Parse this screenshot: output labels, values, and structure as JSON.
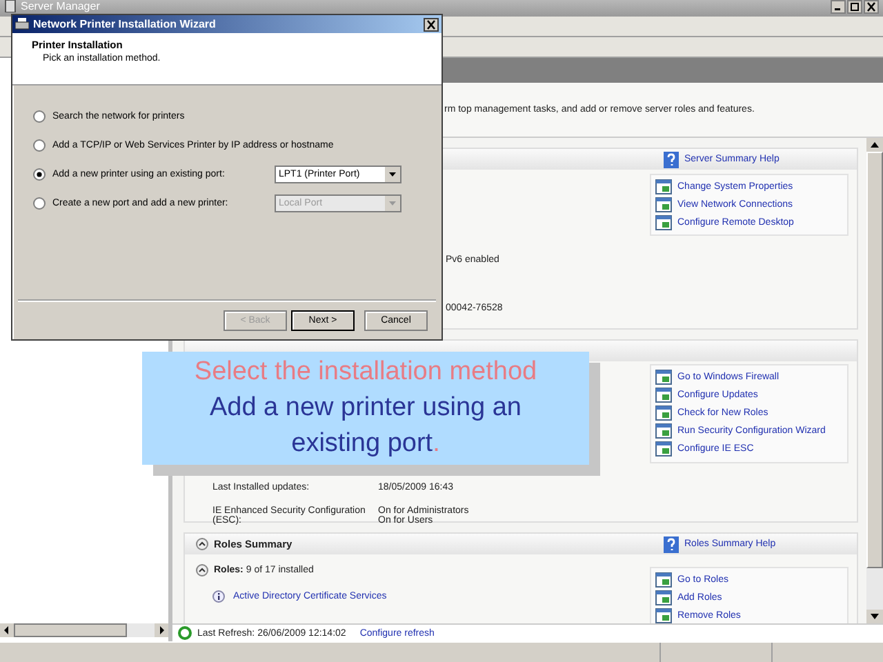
{
  "server_manager": {
    "title": "Server Manager",
    "description": "rm top management tasks, and add or remove server roles and features.",
    "server_summary": {
      "help": "Server Summary Help",
      "details": [
        "Pv6 enabled",
        "00042-76528"
      ],
      "tasks": [
        "Change System Properties",
        "View Network Connections",
        "Configure Remote Desktop"
      ]
    },
    "security": {
      "tasks": [
        "Go to Windows Firewall",
        "Configure Updates",
        "Check for New Roles",
        "Run Security Configuration Wizard",
        "Configure IE ESC"
      ],
      "details": [
        {
          "label": "Last Installed updates:",
          "values": [
            "18/05/2009 16:43"
          ]
        },
        {
          "label": "IE Enhanced Security Configuration (ESC):",
          "values": [
            "On for Administrators",
            "On for Users"
          ]
        }
      ]
    },
    "roles_summary": {
      "title": "Roles Summary",
      "help": "Roles Summary Help",
      "roles_label": "Roles:",
      "roles_count": "9 of 17 installed",
      "roles": [
        "Active Directory Certificate Services"
      ],
      "tasks": [
        "Go to Roles",
        "Add Roles",
        "Remove Roles"
      ]
    },
    "last_refresh": "Last Refresh: 26/06/2009 12:14:02",
    "configure_refresh": "Configure refresh"
  },
  "wizard": {
    "title": "Network Printer Installation Wizard",
    "heading": "Printer Installation",
    "subheading": "Pick an installation method.",
    "options": [
      {
        "label": "Search the network for printers",
        "selected": false
      },
      {
        "label": "Add a TCP/IP or Web Services Printer by IP address or hostname",
        "selected": false
      },
      {
        "label": "Add a new printer using an existing port:",
        "selected": true,
        "port": {
          "value": "LPT1  (Printer Port)",
          "disabled": false
        }
      },
      {
        "label": "Create a new port and add a new printer:",
        "selected": false,
        "port": {
          "value": "Local Port",
          "disabled": true
        }
      }
    ],
    "buttons": [
      {
        "label": "< Back",
        "disabled": true,
        "default": false
      },
      {
        "label": "Next >",
        "disabled": false,
        "default": true
      },
      {
        "label": "Cancel",
        "disabled": false,
        "default": false
      }
    ]
  },
  "callout": {
    "title": "Select the installation method",
    "body": "Add a new printer using an existing port",
    "end_mark": "."
  }
}
